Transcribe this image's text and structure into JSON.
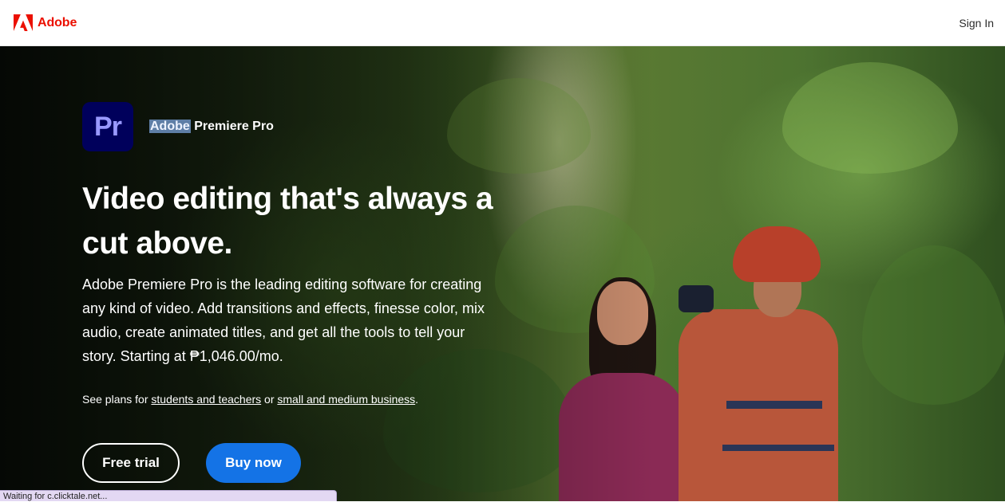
{
  "header": {
    "brand_name": "Adobe",
    "sign_in_label": "Sign In"
  },
  "hero": {
    "product_icon_text": "Pr",
    "product_name_highlight": "Adobe",
    "product_name_rest": " Premiere Pro",
    "headline": "Video editing that's always a cut above.",
    "description": "Adobe Premiere Pro is the leading editing software for creating any kind of video. Add transitions and effects, finesse color, mix audio, create animated titles, and get all the tools to tell your story. Starting at ₱1,046.00/mo.",
    "plans_prefix": "See plans for ",
    "plans_link_students": "students and teachers",
    "plans_or": " or ",
    "plans_link_business": "small and medium business",
    "plans_suffix": ".",
    "free_trial_label": "Free trial",
    "buy_now_label": "Buy now"
  },
  "status_bar": {
    "text": "Waiting for c.clicktale.net..."
  },
  "colors": {
    "brand_red": "#eb1000",
    "premiere_bg": "#00005b",
    "premiere_fg": "#9999ff",
    "buy_blue": "#1473e6"
  }
}
